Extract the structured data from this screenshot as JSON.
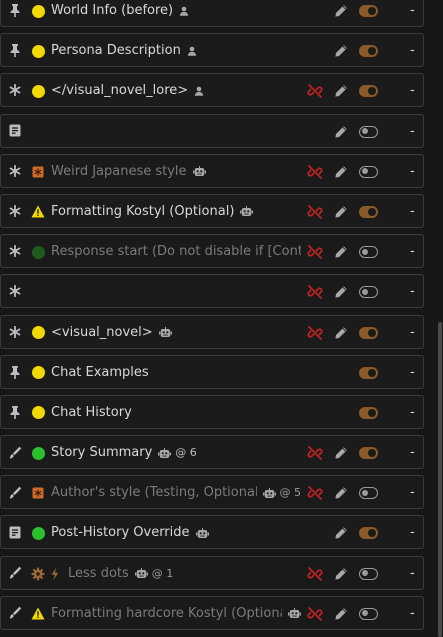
{
  "colors": {
    "yellow": "#f0d800",
    "green": "#2bc02b",
    "dark_green": "#1f5a1f",
    "orange": "#d06a2a",
    "toggle_on": "#8a5a2b"
  },
  "prompts": [
    {
      "name": "World Info (before)",
      "type_icon": "pin-icon",
      "status": "yellow-dot",
      "role": "user",
      "depth": "",
      "link": false,
      "pencil": true,
      "toggle_on": true,
      "enabled": true,
      "tokens": "-"
    },
    {
      "name": "Persona Description",
      "type_icon": "pin-icon",
      "status": "yellow-dot",
      "role": "user",
      "depth": "",
      "link": false,
      "pencil": true,
      "toggle_on": true,
      "enabled": true,
      "tokens": "-"
    },
    {
      "name": "</visual_novel_lore>",
      "type_icon": "asterisk-icon",
      "status": "yellow-dot",
      "role": "user",
      "depth": "",
      "link": true,
      "pencil": true,
      "toggle_on": true,
      "enabled": true,
      "tokens": "-"
    },
    {
      "name": "",
      "type_icon": "document-icon",
      "status": "",
      "role": "",
      "depth": "",
      "link": false,
      "pencil": true,
      "toggle_on": false,
      "enabled": true,
      "tokens": "-"
    },
    {
      "name": "Weird Japanese style",
      "type_icon": "asterisk-icon",
      "status": "orange-square",
      "role": "bot",
      "depth": "",
      "link": true,
      "pencil": true,
      "toggle_on": false,
      "enabled": false,
      "tokens": "-"
    },
    {
      "name": "Formatting Kostyl (Optional)",
      "type_icon": "asterisk-icon",
      "status": "warning-triangle",
      "role": "bot",
      "depth": "",
      "link": true,
      "pencil": true,
      "toggle_on": true,
      "enabled": true,
      "tokens": "-"
    },
    {
      "name": "Response start (Do not disable if [Contin",
      "type_icon": "asterisk-icon",
      "status": "dark-green-dot",
      "role": "",
      "depth": "",
      "link": true,
      "pencil": true,
      "toggle_on": false,
      "enabled": false,
      "tokens": "-"
    },
    {
      "name": "",
      "type_icon": "asterisk-icon",
      "status": "",
      "role": "",
      "depth": "",
      "link": true,
      "pencil": true,
      "toggle_on": false,
      "enabled": false,
      "tokens": "-"
    },
    {
      "name": "<visual_novel>",
      "type_icon": "asterisk-icon",
      "status": "yellow-dot",
      "role": "bot",
      "depth": "",
      "link": true,
      "pencil": true,
      "toggle_on": true,
      "enabled": true,
      "tokens": "-"
    },
    {
      "name": "Chat Examples",
      "type_icon": "pin-icon",
      "status": "yellow-dot",
      "role": "",
      "depth": "",
      "link": false,
      "pencil": false,
      "toggle_on": true,
      "enabled": true,
      "tokens": "-"
    },
    {
      "name": "Chat History",
      "type_icon": "pin-icon",
      "status": "yellow-dot",
      "role": "",
      "depth": "",
      "link": false,
      "pencil": false,
      "toggle_on": true,
      "enabled": true,
      "tokens": "-"
    },
    {
      "name": "Story Summary",
      "type_icon": "brush-icon",
      "status": "green-dot",
      "role": "bot",
      "depth": "@ 6",
      "link": true,
      "pencil": true,
      "toggle_on": true,
      "enabled": true,
      "tokens": "-"
    },
    {
      "name": "Author's style (Testing, Optional)",
      "type_icon": "brush-icon",
      "status": "orange-square",
      "role": "bot",
      "depth": "@ 5",
      "link": true,
      "pencil": true,
      "toggle_on": false,
      "enabled": false,
      "tokens": "-"
    },
    {
      "name": "Post-History Override",
      "type_icon": "document-icon",
      "status": "green-dot",
      "role": "bot",
      "depth": "",
      "link": false,
      "pencil": true,
      "toggle_on": true,
      "enabled": true,
      "tokens": "-"
    },
    {
      "name": "Less dots",
      "type_icon": "brush-icon",
      "status": "gear-bolt",
      "role": "bot",
      "depth": "@ 1",
      "link": true,
      "pencil": true,
      "toggle_on": false,
      "enabled": false,
      "tokens": "-"
    },
    {
      "name": "Formatting hardcore Kostyl (Optional)",
      "type_icon": "brush-icon",
      "status": "warning-triangle",
      "role": "bot",
      "depth": "",
      "link": true,
      "pencil": true,
      "toggle_on": false,
      "enabled": false,
      "tokens": "-"
    }
  ]
}
